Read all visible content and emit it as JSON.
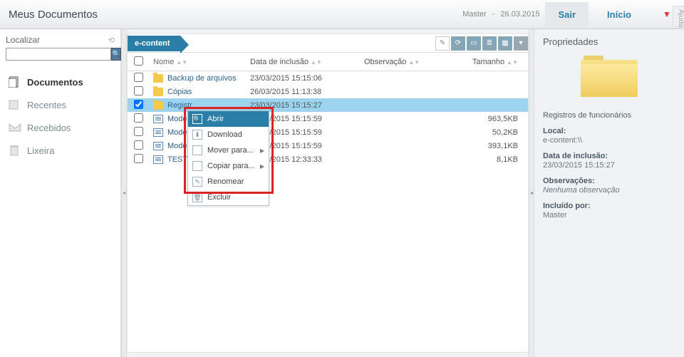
{
  "header": {
    "title": "Meus Documentos",
    "user": "Master",
    "date": "26.03.2015",
    "sep": " - ",
    "sair": "Sair",
    "inicio": "Início",
    "dropdown": "▼",
    "ajuda": "Ajuda"
  },
  "sidebar": {
    "localizar": "Localizar",
    "search_value": "",
    "items": [
      {
        "label": "Documentos",
        "active": true
      },
      {
        "label": "Recentes",
        "active": false
      },
      {
        "label": "Recebidos",
        "active": false
      },
      {
        "label": "Lixeira",
        "active": false
      }
    ]
  },
  "toolbar": {
    "breadcrumb": "e-content"
  },
  "columns": {
    "nome": "Nome",
    "data": "Data de inclusão",
    "obs": "Observação",
    "tamanho": "Tamanho"
  },
  "rows": [
    {
      "type": "folder",
      "name": "Backup de arquivos",
      "date": "23/03/2015 15:15:06",
      "obs": "",
      "size": "",
      "checked": false,
      "selected": false
    },
    {
      "type": "folder",
      "name": "Cópias",
      "date": "26/03/2015 11:13:38",
      "obs": "",
      "size": "",
      "checked": false,
      "selected": false
    },
    {
      "type": "folder",
      "name": "Registros de funcionários",
      "trunc": "Registr",
      "date": "23/03/2015 15:15:27",
      "obs": "",
      "size": "",
      "checked": true,
      "selected": true
    },
    {
      "type": "doc",
      "name": "Modelo-",
      "date": "23/03/2015 15:15:59",
      "obs": "",
      "size": "963,5KB",
      "checked": false,
      "selected": false
    },
    {
      "type": "doc",
      "name": "Modelo-",
      "date": "23/03/2015 15:15:59",
      "obs": "",
      "size": "50,2KB",
      "checked": false,
      "selected": false
    },
    {
      "type": "doc",
      "name": "Modelo-",
      "date": "23/03/2015 15:15:59",
      "obs": "",
      "size": "393,1KB",
      "checked": false,
      "selected": false
    },
    {
      "type": "doc",
      "name": "TESTE-",
      "date": "24/03/2015 12:33:33",
      "obs": "",
      "size": "8,1KB",
      "checked": false,
      "selected": false
    }
  ],
  "context_menu": {
    "items": [
      {
        "label": "Abrir",
        "icon": "magnify-icon",
        "hover": true,
        "submenu": false
      },
      {
        "label": "Download",
        "icon": "download-icon",
        "hover": false,
        "submenu": false
      },
      {
        "label": "Mover para...",
        "icon": "",
        "hover": false,
        "submenu": true
      },
      {
        "label": "Copiar para...",
        "icon": "",
        "hover": false,
        "submenu": true
      },
      {
        "label": "Renomear",
        "icon": "rename-icon",
        "hover": false,
        "submenu": false
      },
      {
        "label": "Excluir",
        "icon": "trash-icon",
        "hover": false,
        "submenu": false
      }
    ]
  },
  "properties": {
    "title": "Propriedades",
    "selected_name": "Registros de funcionários",
    "local_label": "Local:",
    "local_value": "e-content:\\\\",
    "data_label": "Data de inclusão:",
    "data_value": "23/03/2015 15:15:27",
    "obs_label": "Observações:",
    "obs_value": "Nenhuma observação",
    "incl_label": "Incluído por:",
    "incl_value": "Master"
  }
}
